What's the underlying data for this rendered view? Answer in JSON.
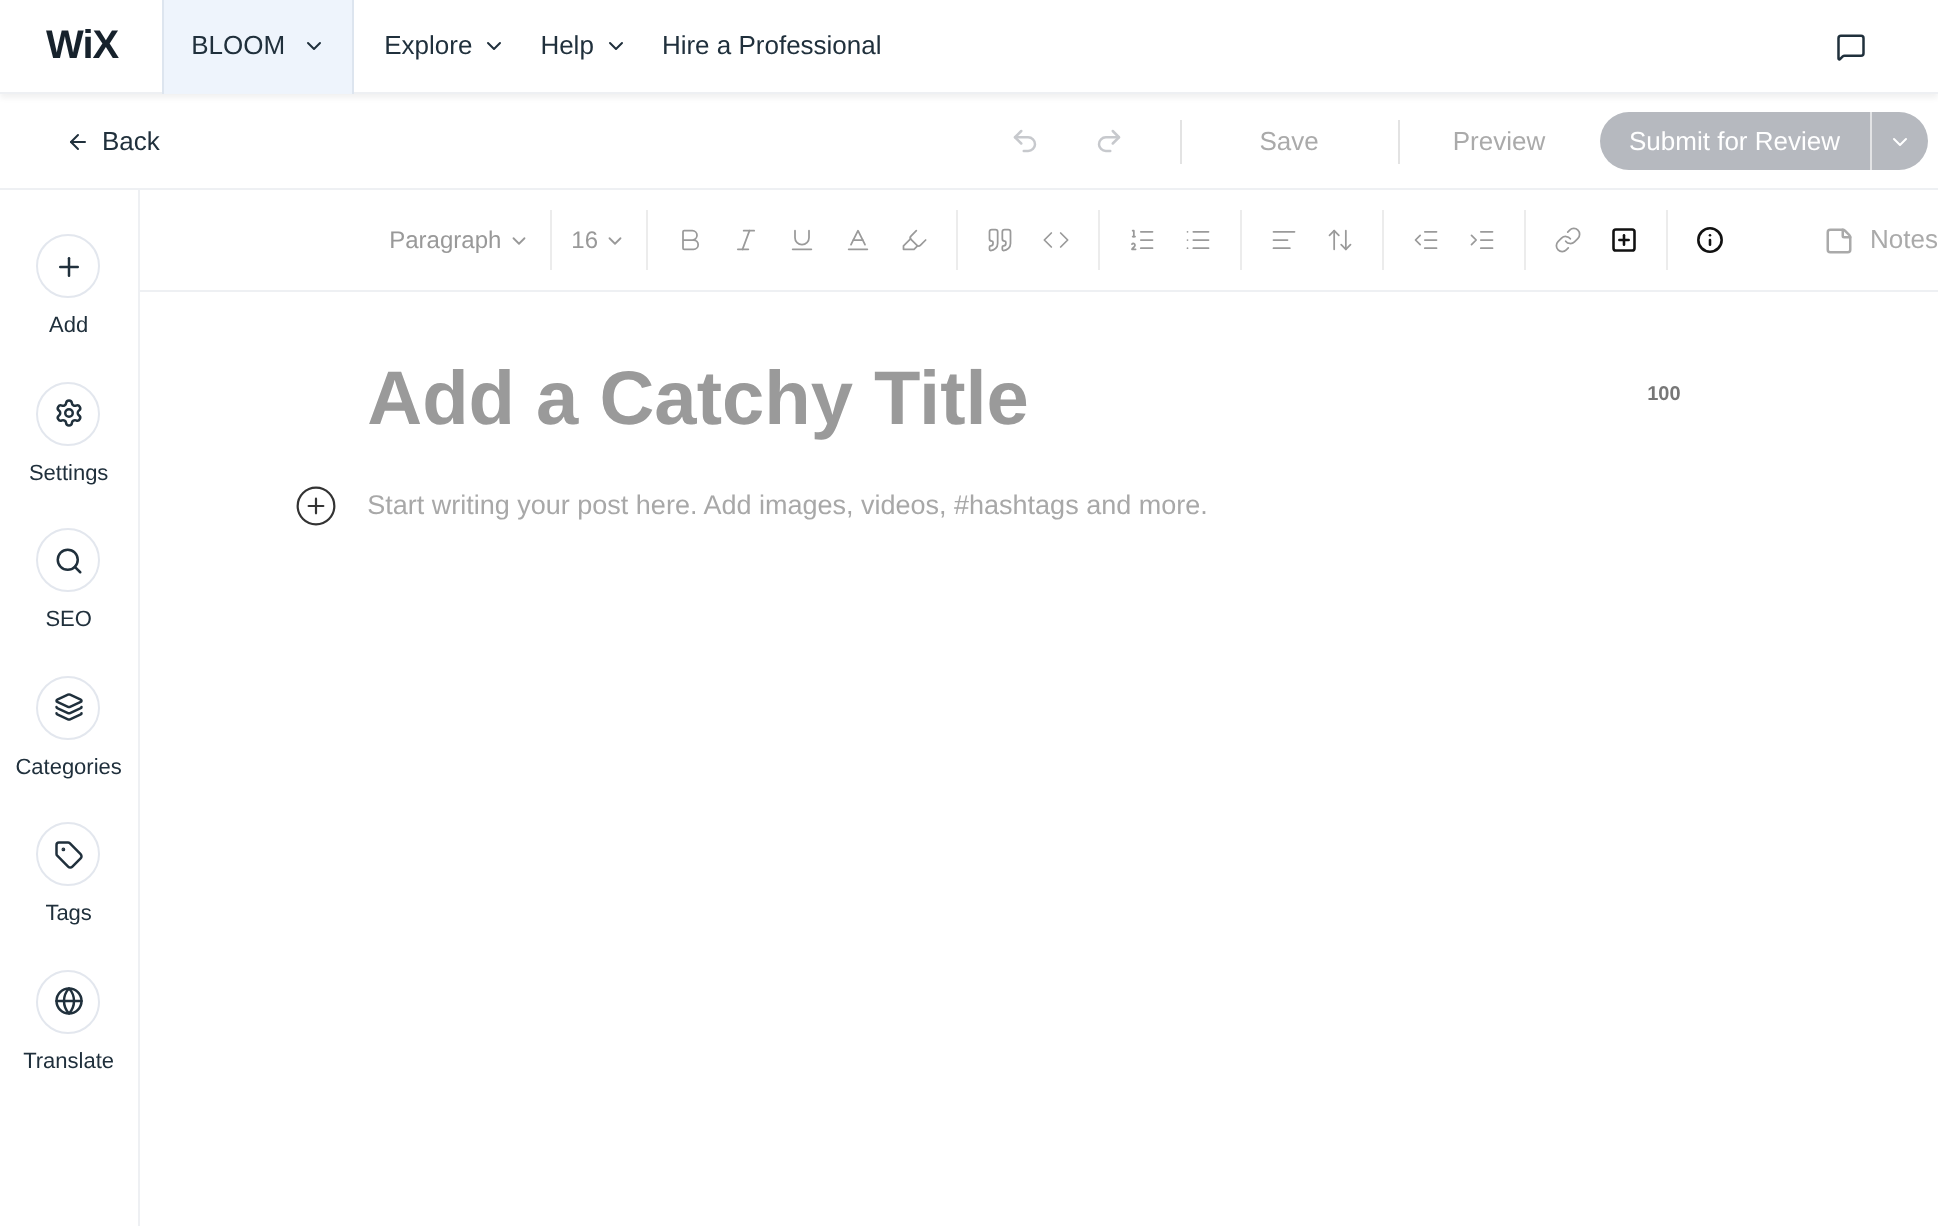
{
  "top_bar": {
    "logo": "WiX",
    "site": {
      "label": "BLOOM",
      "selected": true
    },
    "menus": [
      {
        "label": "Explore",
        "dropdown": true
      },
      {
        "label": "Help",
        "dropdown": true
      },
      {
        "label": "Hire a Professional",
        "dropdown": false
      }
    ]
  },
  "action_bar": {
    "back": "Back",
    "save": "Save",
    "preview": "Preview",
    "submit": "Submit for Review"
  },
  "sidebar": {
    "items": [
      {
        "label": "Add"
      },
      {
        "label": "Settings"
      },
      {
        "label": "SEO"
      },
      {
        "label": "Categories"
      },
      {
        "label": "Tags"
      },
      {
        "label": "Translate"
      }
    ]
  },
  "toolbar": {
    "paragraph_style": "Paragraph",
    "font_size": "16",
    "notes": "Notes"
  },
  "editor": {
    "title_placeholder": "Add a Catchy Title",
    "title_counter": "100",
    "body_placeholder": "Start writing your post here. Add images, videos, #hashtags and more."
  }
}
